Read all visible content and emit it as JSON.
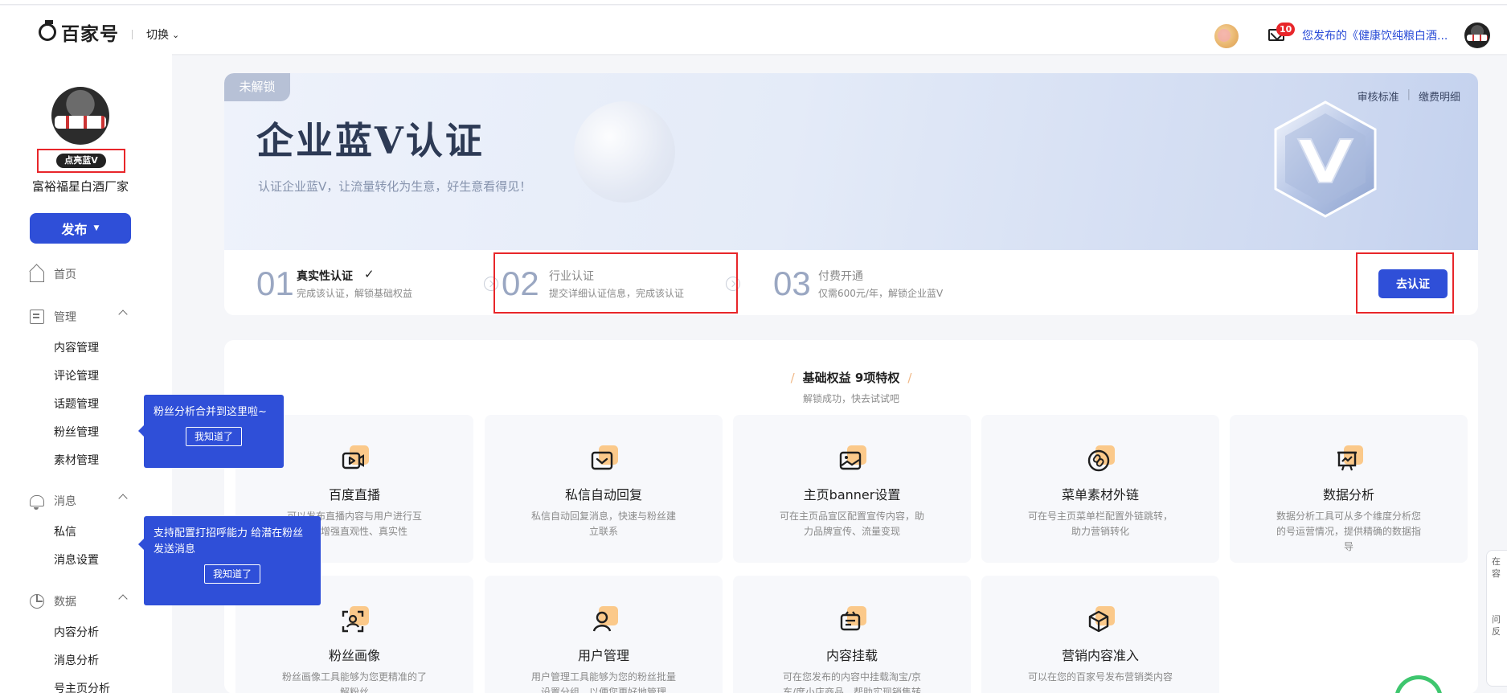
{
  "header": {
    "logo_text": "百家号",
    "switch_label": "切换",
    "mail_count": "10",
    "notice": "您发布的《健康饮纯粮白酒..."
  },
  "sidebar": {
    "blue_v_label": "点亮蓝V",
    "profile_name": "富裕福星白酒厂家",
    "publish_label": "发布",
    "home": "首页",
    "groups": [
      {
        "label": "管理",
        "items": [
          "内容管理",
          "评论管理",
          "话题管理",
          "粉丝管理",
          "素材管理"
        ]
      },
      {
        "label": "消息",
        "items": [
          "私信",
          "消息设置"
        ]
      },
      {
        "label": "数据",
        "items": [
          "内容分析",
          "消息分析",
          "号主页分析"
        ]
      }
    ]
  },
  "tooltips": [
    {
      "text": "粉丝分析合并到这里啦~",
      "button": "我知道了"
    },
    {
      "text": "支持配置打招呼能力 给潜在粉丝发送消息",
      "button": "我知道了"
    }
  ],
  "hero": {
    "tag": "未解锁",
    "title": "企业蓝V认证",
    "subtitle": "认证企业蓝V，让流量转化为生意，好生意看得见！",
    "links": [
      "审核标准",
      "缴费明细"
    ]
  },
  "steps": [
    {
      "num": "01",
      "title": "真实性认证",
      "desc": "完成该认证，解锁基础权益",
      "done": true
    },
    {
      "num": "02",
      "title": "行业认证",
      "desc": "提交详细认证信息，完成该认证",
      "done": false
    },
    {
      "num": "03",
      "title": "付费开通",
      "desc": "仅需600元/年，解锁企业蓝V",
      "done": false
    }
  ],
  "go_button": "去认证",
  "benefits": {
    "title": "基础权益  9项特权",
    "subtitle": "解锁成功，快去试试吧",
    "cards": [
      {
        "icon": "live-video-icon",
        "title": "百度直播",
        "desc": "可以发布直播内容与用户进行互动，增强直观性、真实性"
      },
      {
        "icon": "message-reply-icon",
        "title": "私信自动回复",
        "desc": "私信自动回复消息，快速与粉丝建立联系"
      },
      {
        "icon": "banner-image-icon",
        "title": "主页banner设置",
        "desc": "可在主页品宣区配置宣传内容，助力品牌宣传、流量变现"
      },
      {
        "icon": "link-icon",
        "title": "菜单素材外链",
        "desc": "可在号主页菜单栏配置外链跳转，助力营销转化"
      },
      {
        "icon": "chart-board-icon",
        "title": "数据分析",
        "desc": "数据分析工具可从多个维度分析您的号运营情况，提供精确的数据指导"
      },
      {
        "icon": "fan-portrait-icon",
        "title": "粉丝画像",
        "desc": "粉丝画像工具能够为您更精准的了解粉丝"
      },
      {
        "icon": "user-manage-icon",
        "title": "用户管理",
        "desc": "用户管理工具能够为您的粉丝批量设置分组，以便您更好地管理"
      },
      {
        "icon": "shop-mount-icon",
        "title": "内容挂载",
        "desc": "可在您发布的内容中挂载淘宝/京东/度小店商品，帮助实现销售转化"
      },
      {
        "icon": "cube-box-icon",
        "title": "营销内容准入",
        "desc": "可以在您的百家号发布营销类内容"
      }
    ]
  },
  "right_float": {
    "line1": "在",
    "line2": "容",
    "line3": "问",
    "line4": "反"
  },
  "colors": {
    "primary": "#2f4fd8",
    "highlight_red": "#e8262a",
    "accent_orange": "#fbc98a"
  }
}
